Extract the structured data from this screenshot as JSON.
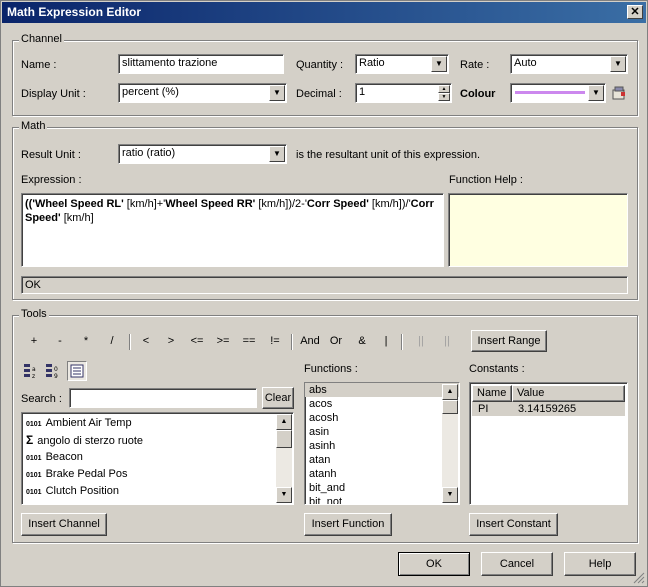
{
  "window": {
    "title": "Math Expression Editor",
    "close": "✕"
  },
  "channel": {
    "group_label": "Channel",
    "name_label": "Name :",
    "name_value": "slittamento trazione",
    "quantity_label": "Quantity :",
    "quantity_value": "Ratio",
    "rate_label": "Rate :",
    "rate_value": "Auto",
    "display_unit_label": "Display Unit :",
    "display_unit_value": "percent (%)",
    "decimal_label": "Decimal :",
    "decimal_value": "1",
    "colour_label": "Colour",
    "colour_value": "#cc88ee"
  },
  "math": {
    "group_label": "Math",
    "result_unit_label": "Result Unit :",
    "result_unit_value": "ratio (ratio)",
    "result_unit_note": "is the resultant unit of this expression.",
    "expression_label": "Expression :",
    "function_help_label": "Function Help :",
    "expression_parts": [
      "(('",
      "Wheel Speed RL'",
      " [km/h]+'",
      "Wheel Speed RR'",
      " [km/h])/2-'",
      "Corr Speed'",
      " [km/h])/'",
      "Corr Speed'",
      " [km/h]"
    ],
    "status": "OK"
  },
  "tools": {
    "group_label": "Tools",
    "operators": [
      "+",
      "-",
      "*",
      "/",
      "<",
      ">",
      "<=",
      ">=",
      "==",
      "!=",
      "And",
      "Or",
      "&",
      "|",
      "||",
      "||"
    ],
    "insert_range": "Insert Range",
    "search_label": "Search :",
    "clear": "Clear",
    "channels": [
      {
        "icon": "0101",
        "name": "Ambient Air Temp"
      },
      {
        "icon": "Σ",
        "name": "angolo di sterzo ruote"
      },
      {
        "icon": "0101",
        "name": "Beacon"
      },
      {
        "icon": "0101",
        "name": "Brake Pedal Pos"
      },
      {
        "icon": "0101",
        "name": "Clutch Position"
      }
    ],
    "functions_label": "Functions :",
    "functions": [
      "abs",
      "acos",
      "acosh",
      "asin",
      "asinh",
      "atan",
      "atanh",
      "bit_and",
      "bit_not"
    ],
    "constants_label": "Constants :",
    "constants_headers": [
      "Name",
      "Value"
    ],
    "constants": [
      {
        "name": "PI",
        "value": "3.14159265"
      }
    ],
    "insert_channel": "Insert Channel",
    "insert_function": "Insert Function",
    "insert_constant": "Insert Constant"
  },
  "footer": {
    "ok": "OK",
    "cancel": "Cancel",
    "help": "Help"
  }
}
